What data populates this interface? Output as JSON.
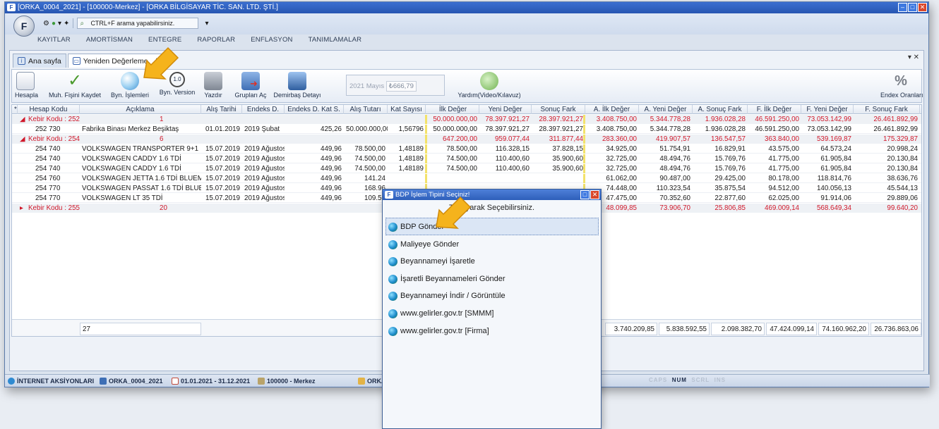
{
  "window": {
    "title": "[ORKA_0004_2021]  -  [100000-Merkez]  -  [ORKA BİLGİSAYAR TİC. SAN. LTD. ŞTİ.]"
  },
  "quickbar": {
    "search_hint": "CTRL+F arama yapabilirsiniz."
  },
  "menu": [
    "KAYITLAR",
    "AMORTİSMAN",
    "ENTEGRE",
    "RAPORLAR",
    "ENFLASYON",
    "TANIMLAMALAR"
  ],
  "tabs": [
    {
      "label": "Ana sayfa"
    },
    {
      "label": "Yeniden Değerleme",
      "close": "✕"
    }
  ],
  "tab_tools": "▾  ✕",
  "toolbar": {
    "hesapla": "Hesapla",
    "muh_fisini_kaydet": "Muh. Fişini Kaydet",
    "byn_islemleri": "Byn. İşlemleri",
    "byn_version": "Byn. Version",
    "yazdir": "Yazdır",
    "gruplari_ac": "Grupları Aç",
    "demirbas_detayi": "Demirbaş Detayı",
    "period_label": "2021 Mayıs",
    "period_value": "666,79",
    "yardim": "Yardım(Video/Kılavuz)",
    "endex_oranlari": "Endex Oranları"
  },
  "grid": {
    "columns": [
      "Hesap Kodu",
      "Açıklama",
      "Alış Tarihi",
      "Endeks D.",
      "Endeks D. Kat S.",
      "Alış Tutarı",
      "Kat Sayısı",
      "İlk Değer",
      "Yeni Değer",
      "Sonuç Fark",
      "A. İlk Değer",
      "A. Yeni Değer",
      "A. Sonuç Fark",
      "F. İlk Değer",
      "F. Yeni Değer",
      "F. Sonuç Fark"
    ],
    "groups": [
      {
        "label": "Kebir Kodu : 252",
        "count": "1",
        "expander": "◢",
        "totals": [
          "50.000.000,00",
          "78.397.921,27",
          "28.397.921,27",
          "3.408.750,00",
          "5.344.778,28",
          "1.936.028,28",
          "46.591.250,00",
          "73.053.142,99",
          "26.461.892,99"
        ],
        "rows": [
          [
            "252 730",
            "Fabrika Binası Merkez Beşiktaş",
            "01.01.2019",
            "2019 Şubat",
            "425,26",
            "50.000.000,00",
            "1,56796",
            "50.000.000,00",
            "78.397.921,27",
            "28.397.921,27",
            "3.408.750,00",
            "5.344.778,28",
            "1.936.028,28",
            "46.591.250,00",
            "73.053.142,99",
            "26.461.892,99"
          ]
        ]
      },
      {
        "label": "Kebir Kodu : 254",
        "count": "6",
        "expander": "◢",
        "totals": [
          "647.200,00",
          "959.077,44",
          "311.877,44",
          "283.360,00",
          "419.907,57",
          "136.547,57",
          "363.840,00",
          "539.169,87",
          "175.329,87"
        ],
        "rows": [
          [
            "254 740",
            "VOLKSWAGEN TRANSPORTER 9+1",
            "15.07.2019",
            "2019 Ağustos",
            "449,96",
            "78.500,00",
            "1,48189",
            "78.500,00",
            "116.328,15",
            "37.828,15",
            "34.925,00",
            "51.754,91",
            "16.829,91",
            "43.575,00",
            "64.573,24",
            "20.998,24"
          ],
          [
            "254 740",
            "VOLKSWAGEN CADDY 1.6 TDİ",
            "15.07.2019",
            "2019 Ağustos",
            "449,96",
            "74.500,00",
            "1,48189",
            "74.500,00",
            "110.400,60",
            "35.900,60",
            "32.725,00",
            "48.494,76",
            "15.769,76",
            "41.775,00",
            "61.905,84",
            "20.130,84"
          ],
          [
            "254 740",
            "VOLKSWAGEN CADDY 1.6 TDİ",
            "15.07.2019",
            "2019 Ağustos",
            "449,96",
            "74.500,00",
            "1,48189",
            "74.500,00",
            "110.400,60",
            "35.900,60",
            "32.725,00",
            "48.494,76",
            "15.769,76",
            "41.775,00",
            "61.905,84",
            "20.130,84"
          ],
          [
            "254 760",
            "VOLKSWAGEN JETTA  1.6 TDİ BLUEMO",
            "15.07.2019",
            "2019 Ağustos",
            "449,96",
            "141.24",
            "",
            "",
            "",
            "",
            "61.062,00",
            "90.487,00",
            "29.425,00",
            "80.178,00",
            "118.814,76",
            "38.636,76"
          ],
          [
            "254 770",
            "VOLKSWAGEN PASSAT 1.6 TDİ BLUEM(",
            "15.07.2019",
            "2019 Ağustos",
            "449,96",
            "168.96",
            "",
            "",
            "",
            "",
            "74.448,00",
            "110.323,54",
            "35.875,54",
            "94.512,00",
            "140.056,13",
            "45.544,13"
          ],
          [
            "254 770",
            "VOLKSWAGEN LT 35 TDİ",
            "15.07.2019",
            "2019 Ağustos",
            "449,96",
            "109.50",
            "",
            "",
            "",
            "",
            "47.475,00",
            "70.352,60",
            "22.877,60",
            "62.025,00",
            "91.914,06",
            "29.889,06"
          ]
        ]
      },
      {
        "label": "Kebir Kodu : 255",
        "count": "20",
        "expander": "▸",
        "totals": [
          "",
          "",
          "",
          "48.099,85",
          "73.906,70",
          "25.806,85",
          "469.009,14",
          "568.649,34",
          "99.640,20"
        ],
        "rows": []
      }
    ],
    "footer_count": "27",
    "footer_totals": [
      "3.740.209,85",
      "5.838.592,55",
      "2.098.382,70",
      "47.424.099,14",
      "74.160.962,20",
      "26.736.863,06"
    ]
  },
  "statusbar": {
    "internet": "İNTERNET AKSİYONLARI",
    "db": "ORKA_0004_2021",
    "period": "01.01.2021 - 31.12.2021",
    "branch": "100000 - Merkez",
    "orka": "ORKA",
    "caps": "CAPS",
    "num": "NUM",
    "scrl": "SCRL",
    "ins": "INS"
  },
  "dialog": {
    "title": "BDP İşlem Tipini Seçiniz!",
    "hint": "Tıklayarak Seçebilirsiniz.",
    "items": [
      "BDP Gönder",
      "Maliyeye Gönder",
      "Beyannameyi İşaretle",
      "İşaretli Beyannameleri Gönder",
      "Beyannameyi İndir / Görüntüle",
      "www.gelirler.gov.tr [SMMM]",
      "www.gelirler.gov.tr [Firma]"
    ],
    "selected_index": 0
  },
  "colors": {
    "accent": "#2756b2",
    "group_text": "#d0182a",
    "highlight_bar": "#f3e26b",
    "annotation_arrow": "#f5b31c"
  }
}
